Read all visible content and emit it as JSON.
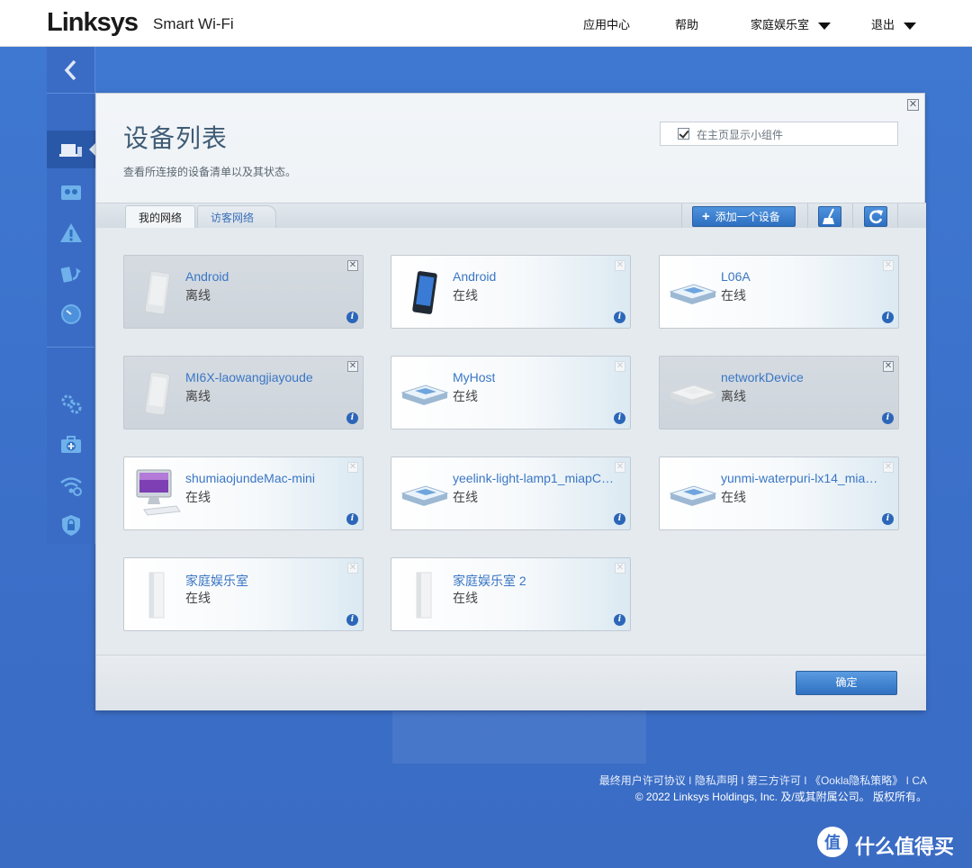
{
  "header": {
    "logo": "Linksys",
    "product": "Smart Wi-Fi",
    "nav": {
      "app_center": "应用中心",
      "help": "帮助",
      "router_name": "家庭娱乐室",
      "logout": "退出"
    }
  },
  "sidebar": {
    "icons": [
      "back-arrow-icon",
      "devices-icon",
      "parental-icon",
      "alert-icon",
      "media-icon",
      "speed-icon",
      "settings-icon",
      "diagnostics-icon",
      "wifi-settings-icon",
      "security-icon"
    ]
  },
  "dialog": {
    "title": "设备列表",
    "subtitle": "查看所连接的设备清单以及其状态。",
    "widget_checkbox_label": "在主页显示小组件",
    "widget_checked": true,
    "tabs": {
      "my_network": "我的网络",
      "guest_network": "访客网络"
    },
    "add_device_label": "添加一个设备",
    "ok_label": "确定",
    "devices": [
      {
        "name": "Android",
        "status": "离线",
        "online": false,
        "type": "phone"
      },
      {
        "name": "Android",
        "status": "在线",
        "online": true,
        "type": "phone"
      },
      {
        "name": "L06A",
        "status": "在线",
        "online": true,
        "type": "box"
      },
      {
        "name": "MI6X-laowangjiayoude",
        "status": "离线",
        "online": false,
        "type": "phone"
      },
      {
        "name": "MyHost",
        "status": "在线",
        "online": true,
        "type": "box"
      },
      {
        "name": "networkDevice",
        "status": "离线",
        "online": false,
        "type": "box"
      },
      {
        "name": "shumiaojundeMac-mini",
        "status": "在线",
        "online": true,
        "type": "imac"
      },
      {
        "name": "yeelink-light-lamp1_miapC…",
        "status": "在线",
        "online": true,
        "type": "box"
      },
      {
        "name": "yunmi-waterpuri-lx14_mia…",
        "status": "在线",
        "online": true,
        "type": "box"
      },
      {
        "name": "家庭娱乐室",
        "status": "在线",
        "online": true,
        "type": "node"
      },
      {
        "name": "家庭娱乐室 2",
        "status": "在线",
        "online": true,
        "type": "node"
      }
    ]
  },
  "footer": {
    "links": [
      "最终用户许可协议",
      "隐私声明",
      "第三方许可",
      "《Ookla隐私策略》",
      "CA"
    ],
    "copyright": "© 2022 Linksys Holdings, Inc. 及/或其附属公司。 版权所有。"
  },
  "watermark": {
    "symbol": "值",
    "text": "什么值得买"
  },
  "colors": {
    "background_blue": "#3a6fc9",
    "link_blue": "#3a76c4",
    "button_blue": "#2f71c2"
  }
}
